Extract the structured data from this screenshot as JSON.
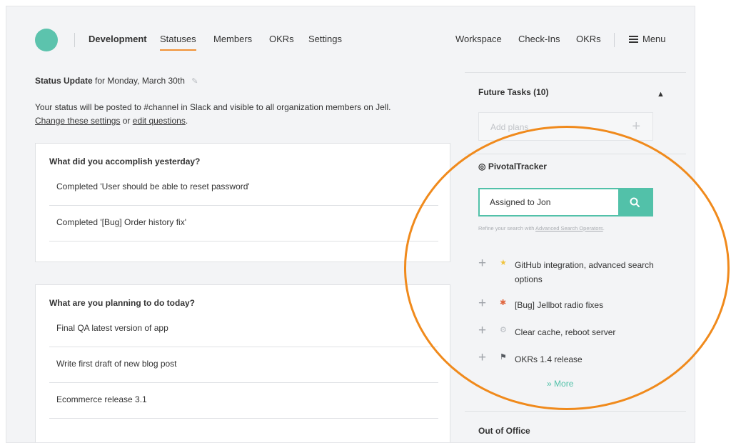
{
  "nav": {
    "team": "Development",
    "left_items": [
      "Statuses",
      "Members",
      "OKRs",
      "Settings"
    ],
    "right_items": [
      "Workspace",
      "Check-Ins",
      "OKRs"
    ],
    "menu_label": "Menu"
  },
  "status": {
    "title": "Status Update",
    "date": "for Monday, March 30th",
    "info_text": "Your status will be posted to #channel in Slack and visible to all organization members on Jell.",
    "change_link": "Change these settings",
    "or_text": " or ",
    "edit_link": "edit questions",
    "period": "."
  },
  "yesterday": {
    "question": "What did you accomplish yesterday?",
    "items": [
      "Completed 'User should be able to reset password'",
      "Completed '[Bug] Order history fix'"
    ]
  },
  "today": {
    "question": "What are you planning to do today?",
    "items": [
      "Final QA latest version of app",
      "Write first draft of new blog post",
      "Ecommerce release 3.1"
    ]
  },
  "sidebar": {
    "future_tasks_title": "Future Tasks (10)",
    "add_plans_placeholder": "Add plans",
    "integration_name": "PivotalTracker",
    "search_value": "Assigned to Jon",
    "refine_text": "Refine your search with ",
    "refine_link": "Advanced Search Operators",
    "refine_period": ".",
    "tasks": [
      {
        "icon": "★",
        "icon_name": "star-icon",
        "icon_color": "#f0c33c",
        "label": "GitHub integration, advanced search options"
      },
      {
        "icon": "✱",
        "icon_name": "bug-icon",
        "icon_color": "#e0643c",
        "label": "[Bug] Jellbot radio fixes"
      },
      {
        "icon": "⚙",
        "icon_name": "gear-icon",
        "icon_color": "#b8bcc2",
        "label": "Clear cache, reboot server"
      },
      {
        "icon": "⚑",
        "icon_name": "flag-icon",
        "icon_color": "#555a60",
        "label": "OKRs 1.4 release"
      }
    ],
    "more_label": "More",
    "out_of_office_title": "Out of Office"
  },
  "colors": {
    "accent": "#52c1a9",
    "nav_active": "#f19135",
    "annotation": "#f08a1c"
  }
}
